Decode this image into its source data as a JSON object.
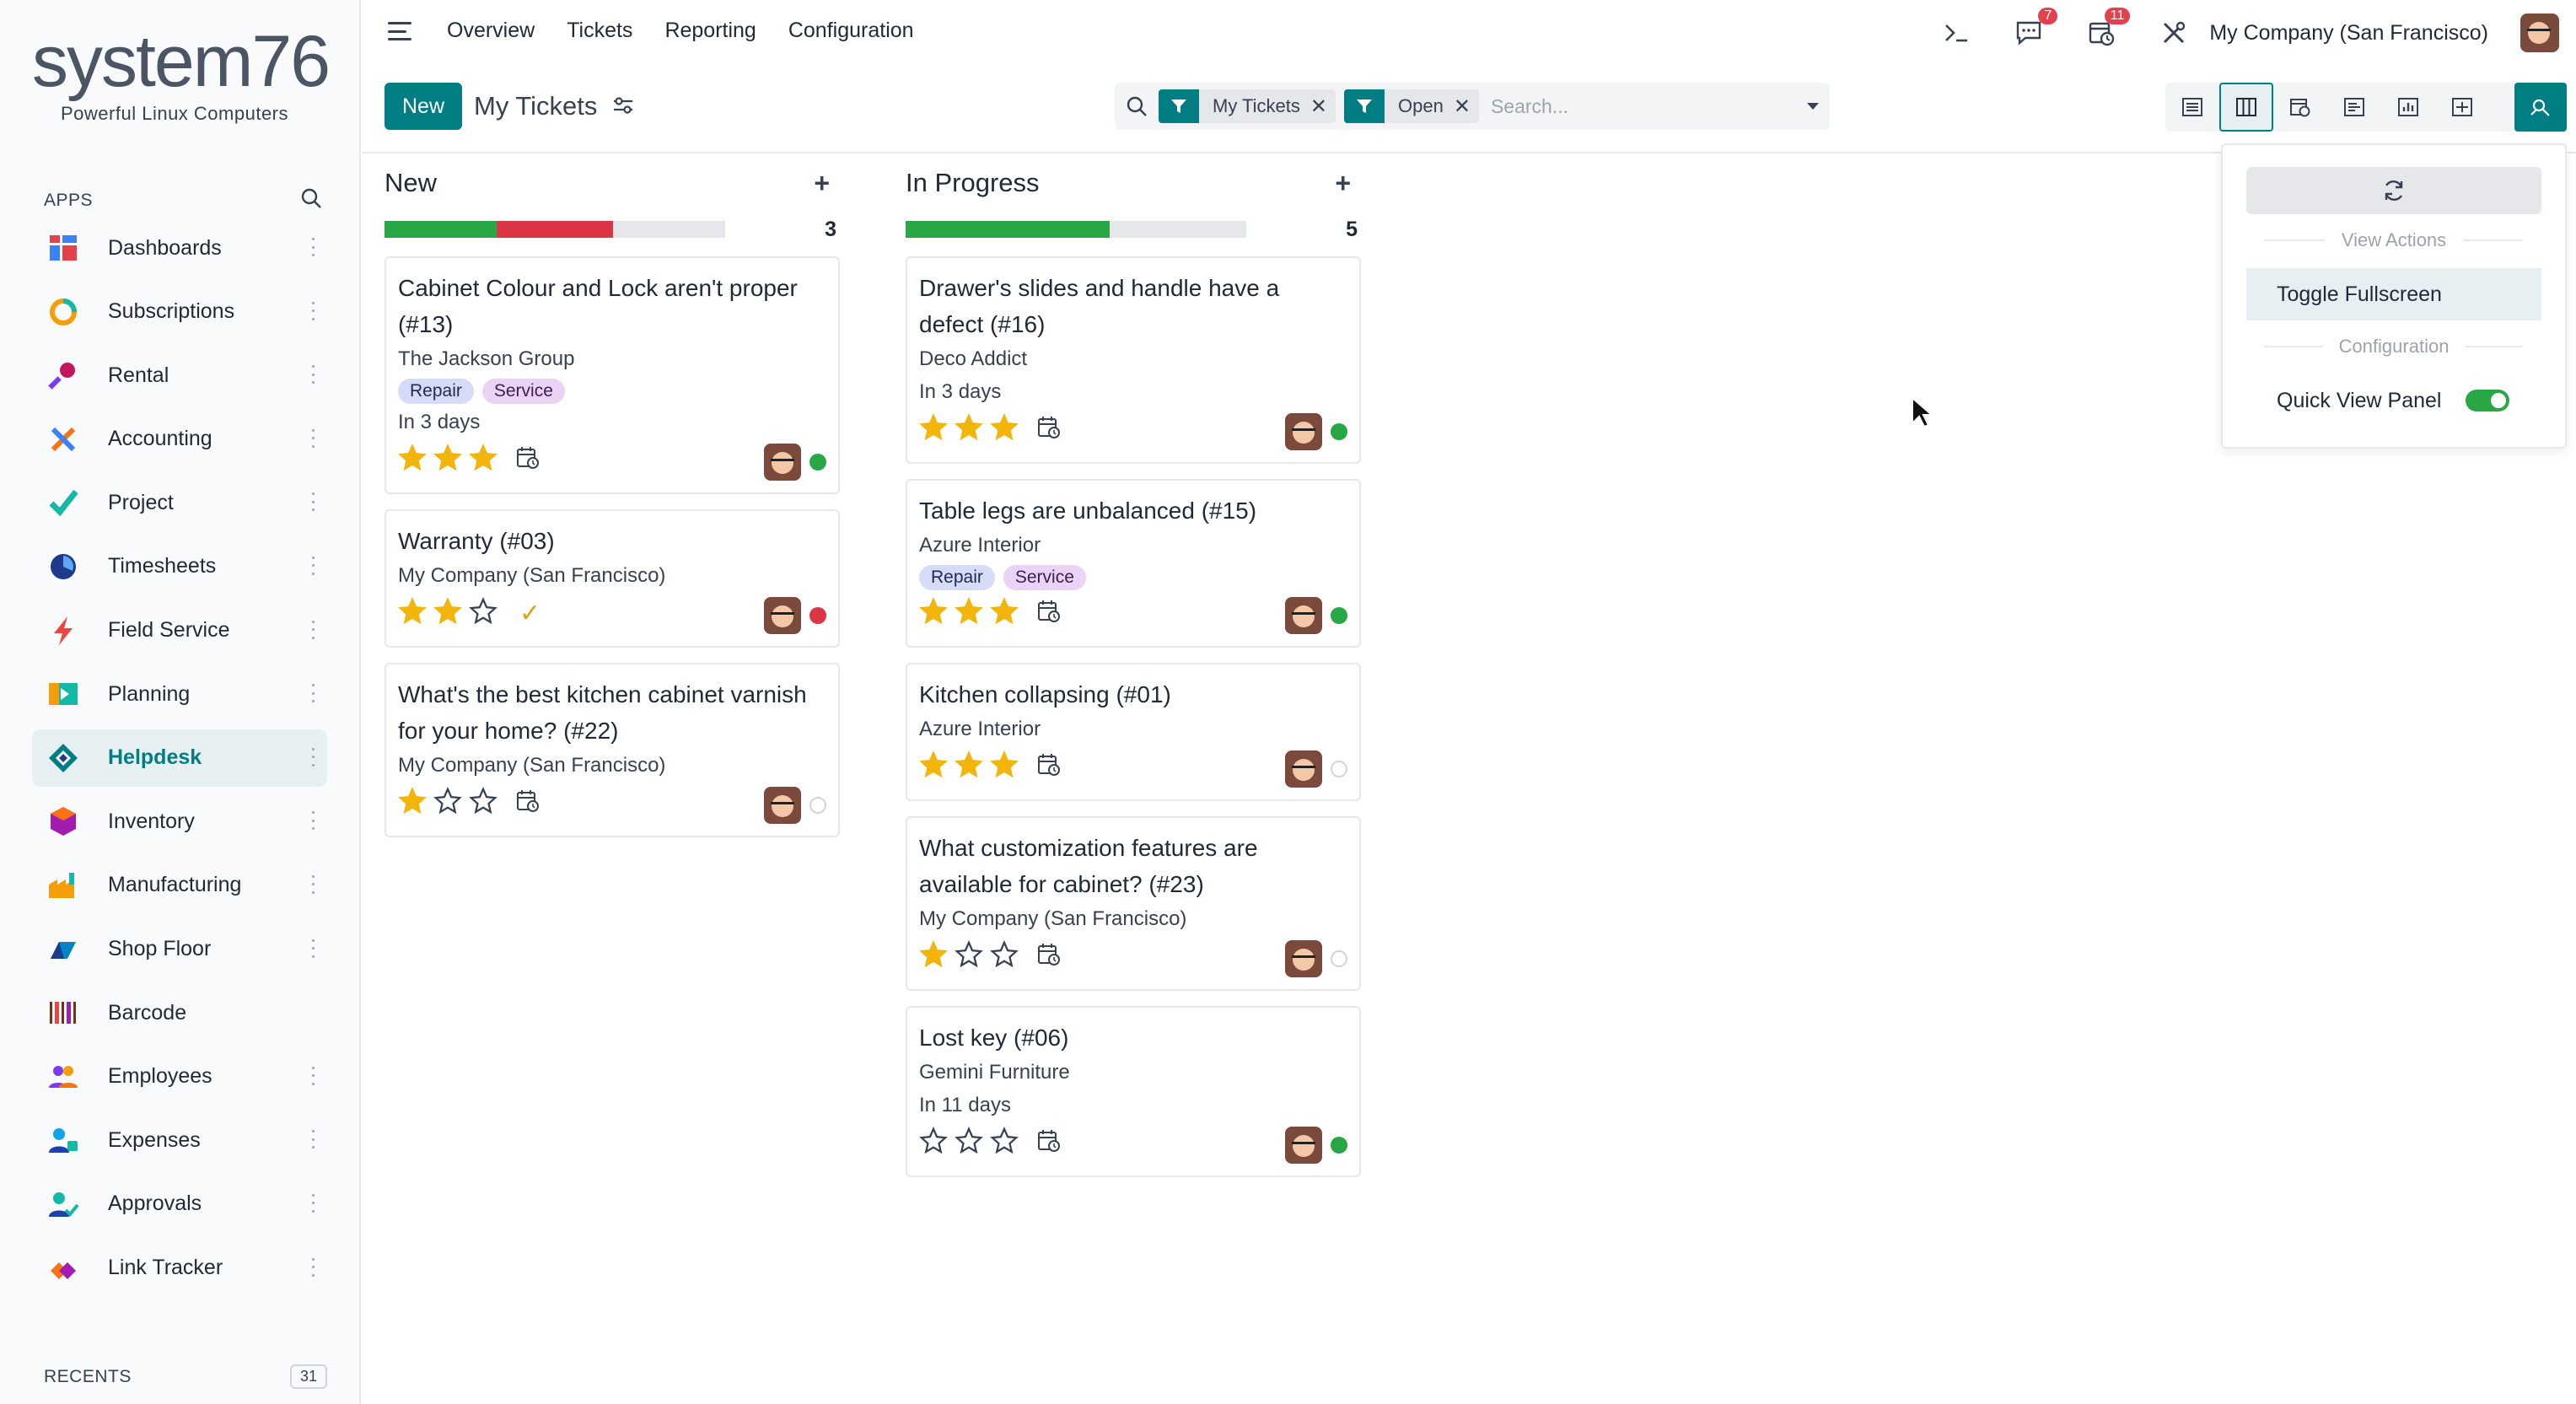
{
  "sidebar": {
    "logo_word": "system76",
    "logo_tagline": "Powerful Linux Computers",
    "apps_label": "APPS",
    "items": [
      {
        "label": "Dashboards",
        "icon": "dashboards-icon",
        "color": "#e4414f"
      },
      {
        "label": "Subscriptions",
        "icon": "subscriptions-icon",
        "color": "#f59e0b"
      },
      {
        "label": "Rental",
        "icon": "rental-icon",
        "color": "#c2185b"
      },
      {
        "label": "Accounting",
        "icon": "accounting-icon",
        "color": "#f97316"
      },
      {
        "label": "Project",
        "icon": "project-icon",
        "color": "#14b8a6"
      },
      {
        "label": "Timesheets",
        "icon": "timesheets-icon",
        "color": "#1e3a8a"
      },
      {
        "label": "Field Service",
        "icon": "field-service-icon",
        "color": "#ef4444"
      },
      {
        "label": "Planning",
        "icon": "planning-icon",
        "color": "#f59e0b"
      },
      {
        "label": "Helpdesk",
        "icon": "helpdesk-icon",
        "color": "#017e84"
      },
      {
        "label": "Inventory",
        "icon": "inventory-icon",
        "color": "#a21caf"
      },
      {
        "label": "Manufacturing",
        "icon": "manufacturing-icon",
        "color": "#f59e0b"
      },
      {
        "label": "Shop Floor",
        "icon": "shop-floor-icon",
        "color": "#0284c7"
      },
      {
        "label": "Barcode",
        "icon": "barcode-icon",
        "color": "#7c2d12"
      },
      {
        "label": "Employees",
        "icon": "employees-icon",
        "color": "#7c3aed"
      },
      {
        "label": "Expenses",
        "icon": "expenses-icon",
        "color": "#0ea5e9"
      },
      {
        "label": "Approvals",
        "icon": "approvals-icon",
        "color": "#14b8a6"
      },
      {
        "label": "Link Tracker",
        "icon": "link-tracker-icon",
        "color": "#f97316"
      }
    ],
    "active_index": 8,
    "recents_label": "RECENTS",
    "recents_count": "31"
  },
  "topbar": {
    "nav": [
      "Overview",
      "Tickets",
      "Reporting",
      "Configuration"
    ],
    "messages_badge": "7",
    "activities_badge": "11",
    "company": "My Company (San Francisco)"
  },
  "control": {
    "new_label": "New",
    "view_title": "My Tickets",
    "facets": [
      "My Tickets",
      "Open"
    ],
    "search_placeholder": "Search..."
  },
  "columns": [
    {
      "title": "New",
      "count": "3",
      "progress": {
        "green": 0.33,
        "red": 0.34
      },
      "cards": [
        {
          "title": "Cabinet Colour and Lock aren't proper (#13)",
          "customer": "The Jackson Group",
          "tags": [
            "Repair",
            "Service"
          ],
          "deadline": "In 3 days",
          "stars": 3,
          "activity": "calendar",
          "status": "green"
        },
        {
          "title": "Warranty (#03)",
          "customer": "My Company (San Francisco)",
          "tags": [],
          "deadline": "",
          "stars": 2,
          "activity": "check",
          "status": "red"
        },
        {
          "title": "What's the best kitchen cabinet varnish for your home? (#22)",
          "customer": "My Company (San Francisco)",
          "tags": [],
          "deadline": "",
          "stars": 1,
          "activity": "calendar",
          "status": "grey"
        }
      ]
    },
    {
      "title": "In Progress",
      "count": "5",
      "progress": {
        "green": 0.6,
        "red": 0
      },
      "cards": [
        {
          "title": "Drawer's slides and handle have a defect (#16)",
          "customer": "Deco Addict",
          "tags": [],
          "deadline": "In 3 days",
          "stars": 3,
          "activity": "calendar",
          "status": "green"
        },
        {
          "title": "Table legs are unbalanced (#15)",
          "customer": "Azure Interior",
          "tags": [
            "Repair",
            "Service"
          ],
          "deadline": "",
          "stars": 3,
          "activity": "calendar",
          "status": "green"
        },
        {
          "title": "Kitchen collapsing (#01)",
          "customer": "Azure Interior",
          "tags": [],
          "deadline": "",
          "stars": 3,
          "activity": "calendar",
          "status": "grey"
        },
        {
          "title": "What customization features are available for cabinet? (#23)",
          "customer": "My Company (San Francisco)",
          "tags": [],
          "deadline": "",
          "stars": 1,
          "activity": "calendar",
          "status": "grey"
        },
        {
          "title": "Lost key (#06)",
          "customer": "Gemini Furniture",
          "tags": [],
          "deadline": "In 11 days",
          "stars": 0,
          "activity": "calendar",
          "status": "green"
        }
      ]
    }
  ],
  "dropdown": {
    "section_view_actions": "View Actions",
    "toggle_fullscreen": "Toggle Fullscreen",
    "section_configuration": "Configuration",
    "quick_view_panel": "Quick View Panel",
    "quick_view_enabled": true
  },
  "colors": {
    "accent": "#017e84",
    "star": "#f3b50b",
    "green": "#28a745",
    "red": "#dc3545"
  }
}
